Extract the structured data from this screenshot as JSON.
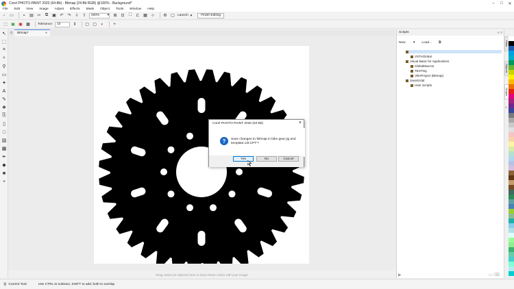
{
  "window": {
    "title": "Corel PHOTO-PAINT 2020 (64-Bit) - Bitmap (24-Bit RGB) @100% - Background*"
  },
  "menu": [
    "File",
    "Edit",
    "View",
    "Image",
    "Adjust",
    "Effects",
    "Mask",
    "Object",
    "Tools",
    "Window",
    "Help"
  ],
  "toolbar": {
    "zoom": "200%",
    "launch_label": "Launch",
    "finish_label": "Finish Editing"
  },
  "propbar": {
    "tolerance_label": "Tolerance:",
    "tolerance_value": "10"
  },
  "doc": {
    "tab_label": "Bitmap*"
  },
  "dialog": {
    "title": "Corel PHOTO-PAINT 2020 (64-Bit)",
    "message": "Save changes to 'Bitmap in bike gear jig and template.cdr.CPT'?",
    "yes_label": "Yes",
    "no_label": "No",
    "cancel_label": "Cancel"
  },
  "scripts": {
    "title": "Scripts",
    "new_label": "New",
    "load_label": "Load...",
    "tree": [
      {
        "label": "Visual Basic for Applications",
        "level": 1,
        "selected": true
      },
      {
        "label": "VSTAGlobal",
        "level": 2
      },
      {
        "label": "Visual Basic for Applications",
        "level": 1
      },
      {
        "label": "GlobalMacros",
        "level": 2
      },
      {
        "label": "TESTing",
        "level": 2
      },
      {
        "label": "VBAProject (Bitmap)",
        "level": 2
      },
      {
        "label": "JavaScript",
        "level": 1
      },
      {
        "label": "User Scripts",
        "level": 2
      }
    ]
  },
  "right_tabs": [
    "Hints",
    "Objects",
    "Scripts"
  ],
  "hint_bar": "Drag colors (or objects) here to store these colors with your image",
  "status": {
    "tool": "Current Tool:",
    "message": "Use CTRL to subtract, SHIFT to add, both to overlap"
  },
  "palette": [
    "#ffffff",
    "#000000",
    "#1e5fb0",
    "#00a0e3",
    "#00b0c8",
    "#00965e",
    "#65b530",
    "#c8d400",
    "#fff000",
    "#fbb900",
    "#ee7203",
    "#e42313",
    "#e6007e",
    "#a3227d",
    "#6e2a8d",
    "#38469b",
    "#7a7a7a",
    "#a8a8a8",
    "#c9c9c9",
    "#e0e0e0",
    "#f4c4c4",
    "#f7d5a8",
    "#fff4a3",
    "#d7eba6",
    "#b6e0d0",
    "#acd9ef",
    "#b8c3e4",
    "#d6bfdf",
    "#8c6239",
    "#603813",
    "#c69c6d",
    "#754c24",
    "#40695f",
    "#2e8b57",
    "#5f9ea0",
    "#4682b4",
    "#9acd32",
    "#8fbc8f",
    "#20b2aa",
    "#87ceeb",
    "#b0e0e6",
    "#e0ffff",
    "#98fb98",
    "#90ee90",
    "#3cb371",
    "#66cdaa",
    "#48d1cc",
    "#7fffd4",
    "#afeeee",
    "#00ced1"
  ]
}
